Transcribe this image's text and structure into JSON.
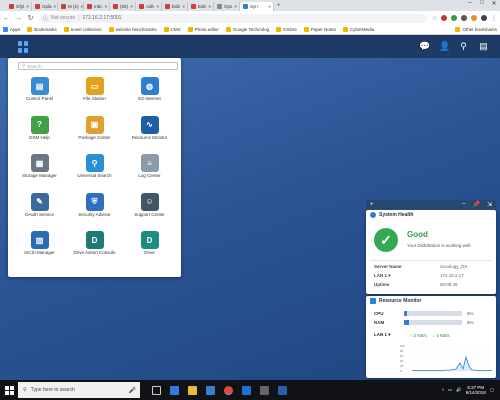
{
  "browser": {
    "tabs": [
      {
        "label": "Gfyl",
        "color": "#c8403a"
      },
      {
        "label": "Gpla",
        "color": "#c8403a"
      },
      {
        "label": "M (1)",
        "color": "#c8403a"
      },
      {
        "label": "Inbc",
        "color": "#c8403a"
      },
      {
        "label": "(26)",
        "color": "#d03a3a"
      },
      {
        "label": "Adh",
        "color": "#c8403a"
      },
      {
        "label": "Edit",
        "color": "#c8403a"
      },
      {
        "label": "Edit",
        "color": "#c8403a"
      },
      {
        "label": "Ops",
        "color": "#888888"
      },
      {
        "label": "Syn",
        "color": "#2f7fd1",
        "active": true
      }
    ],
    "address": {
      "security": "Not secure",
      "url": "172.16.2.17:5001"
    },
    "bookmarks": [
      {
        "label": "Apps",
        "color": "#4285f4"
      },
      {
        "label": "Bookmarks",
        "color": "#f4b400"
      },
      {
        "label": "novel collection",
        "color": "#f4b400"
      },
      {
        "label": "website benchmarks",
        "color": "#f4b400"
      },
      {
        "label": "CMS",
        "color": "#f4b400"
      },
      {
        "label": "Photo editor",
        "color": "#f4b400"
      },
      {
        "label": "Google Technolog",
        "color": "#f4b400"
      },
      {
        "label": "Ombre",
        "color": "#f4b400"
      },
      {
        "label": "Paper Notes",
        "color": "#f4b400"
      },
      {
        "label": "CyberMedia",
        "color": "#f4b400"
      }
    ],
    "other_bookmarks": "Other bookmarks"
  },
  "menu": {
    "search_placeholder": "Search",
    "apps": [
      {
        "label": "Control Panel",
        "icon": "control-panel-icon",
        "color": "#3a8ad6",
        "glyph": "▤"
      },
      {
        "label": "File Station",
        "icon": "folder-icon",
        "color": "#e5a21e",
        "glyph": "▭"
      },
      {
        "label": "EZ-Internet",
        "icon": "globe-icon",
        "color": "#2d7ed1",
        "glyph": "◍"
      },
      {
        "label": "DSM Help",
        "icon": "help-icon",
        "color": "#43a047",
        "glyph": "?"
      },
      {
        "label": "Package Center",
        "icon": "package-icon",
        "color": "#e0a030",
        "glyph": "▣"
      },
      {
        "label": "Resource Monitor",
        "icon": "resource-monitor-icon",
        "color": "#1f5fa8",
        "glyph": "∿"
      },
      {
        "label": "Storage Manager",
        "icon": "storage-icon",
        "color": "#6b7785",
        "glyph": "▦"
      },
      {
        "label": "Universal Search",
        "icon": "magnifier-icon",
        "color": "#2b8fd8",
        "glyph": "⚲"
      },
      {
        "label": "Log Center",
        "icon": "log-icon",
        "color": "#8a9aa8",
        "glyph": "≡"
      },
      {
        "label": "OAuth Service",
        "icon": "oauth-icon",
        "color": "#3c6a9c",
        "glyph": "✎"
      },
      {
        "label": "Security Advisor",
        "icon": "shield-icon",
        "color": "#2d6fc0",
        "glyph": "⛨"
      },
      {
        "label": "Support Center",
        "icon": "support-icon",
        "color": "#445566",
        "glyph": "☺"
      },
      {
        "label": "iSCSI Manager",
        "icon": "iscsi-icon",
        "color": "#2a6bb5",
        "glyph": "▥"
      },
      {
        "label": "Drive Admin Console",
        "icon": "drive-admin-icon",
        "color": "#1e7a76",
        "glyph": "D"
      },
      {
        "label": "Drive",
        "icon": "drive-icon",
        "color": "#1e8a80",
        "glyph": "D"
      }
    ]
  },
  "health": {
    "title": "System Health",
    "status": "Good",
    "message": "Your DiskStation is working well.",
    "server_name_label": "Server Name",
    "server_name": "Scoology_DS",
    "lan_label": "LAN 1",
    "lan_value": "172.16.2.17",
    "uptime_label": "Uptime",
    "uptime_value": "00:05:49"
  },
  "resource": {
    "title": "Resource Monitor",
    "cpu_label": "CPU",
    "cpu_percent": 5,
    "cpu_text": "5%",
    "ram_label": "RAM",
    "ram_percent": 8,
    "ram_text": "8%",
    "lan_label": "LAN 1",
    "up_text": "↑ 2 KB/s",
    "down_text": "↓ 4 KB/s",
    "graph_ticks": [
      "100",
      "80",
      "60",
      "40",
      "20",
      "0"
    ]
  },
  "taskbar": {
    "search_placeholder": "Type here to search",
    "time": "5:37 PM",
    "date": "9/14/2018"
  }
}
